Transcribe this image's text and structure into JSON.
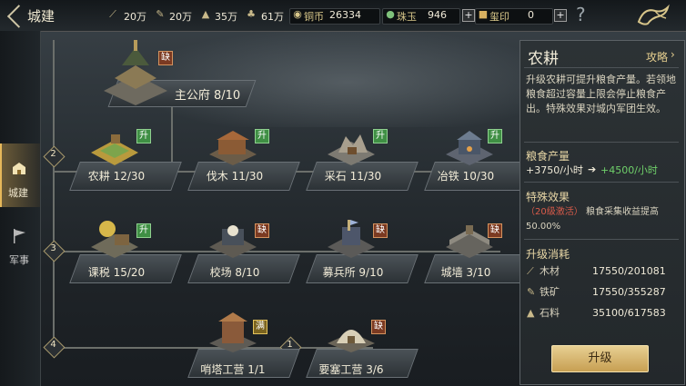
{
  "topbar": {
    "title": "城建",
    "resources": [
      {
        "icon": "wood-icon",
        "value": "20万"
      },
      {
        "icon": "iron-icon",
        "value": "20万"
      },
      {
        "icon": "stone-icon",
        "value": "35万"
      },
      {
        "icon": "grain-icon",
        "value": "61万"
      }
    ],
    "currencies": [
      {
        "icon": "coin-icon",
        "label": "铜币",
        "value": "26334"
      },
      {
        "icon": "jade-icon",
        "label": "珠玉",
        "value": "946"
      },
      {
        "icon": "seal-icon",
        "label": "玺印",
        "value": "0"
      }
    ],
    "help": "?"
  },
  "sidebar": {
    "tabs": [
      {
        "label": "城建",
        "icon": "city-icon",
        "active": true
      },
      {
        "label": "军事",
        "icon": "flag-icon",
        "active": false
      }
    ]
  },
  "tree": {
    "main": {
      "name": "主公府 8/10",
      "badge": "缺"
    },
    "tiers": [
      "2",
      "3",
      "4"
    ],
    "sub_tier": "1",
    "rows": [
      [
        {
          "name": "农耕 12/30",
          "badge": "升"
        },
        {
          "name": "伐木 11/30",
          "badge": "升"
        },
        {
          "name": "采石 11/30",
          "badge": "升"
        },
        {
          "name": "冶铁 10/30",
          "badge": "升"
        }
      ],
      [
        {
          "name": "课税 15/20",
          "badge": "升"
        },
        {
          "name": "校场 8/10",
          "badge": "缺"
        },
        {
          "name": "募兵所 9/10",
          "badge": "缺"
        },
        {
          "name": "城墙 3/10",
          "badge": "缺"
        }
      ],
      [
        {
          "name": "哨塔工营 1/1",
          "badge": "满"
        },
        {
          "name": "要塞工营 3/6",
          "badge": "缺"
        }
      ]
    ]
  },
  "panel": {
    "title": "农耕",
    "guide": "攻略",
    "desc": "升级农耕可提升粮食产量。若领地粮食超过容量上限会停止粮食产出。特殊效果对城内军团生效。",
    "output_title": "粮食产量",
    "output_current": "+3750/小时",
    "output_next": "+4500/小时",
    "effect_title": "特殊效果",
    "effect_cond": "（20级激活）",
    "effect_text": "粮食采集收益提高50.00%",
    "cost_title": "升级消耗",
    "costs": [
      {
        "icon": "wood-icon",
        "label": "木材",
        "value": "17550/201081"
      },
      {
        "icon": "iron-icon",
        "label": "铁矿",
        "value": "17550/355287"
      },
      {
        "icon": "stone-icon",
        "label": "石料",
        "value": "35100/617583"
      }
    ],
    "upgrade": "升级"
  }
}
